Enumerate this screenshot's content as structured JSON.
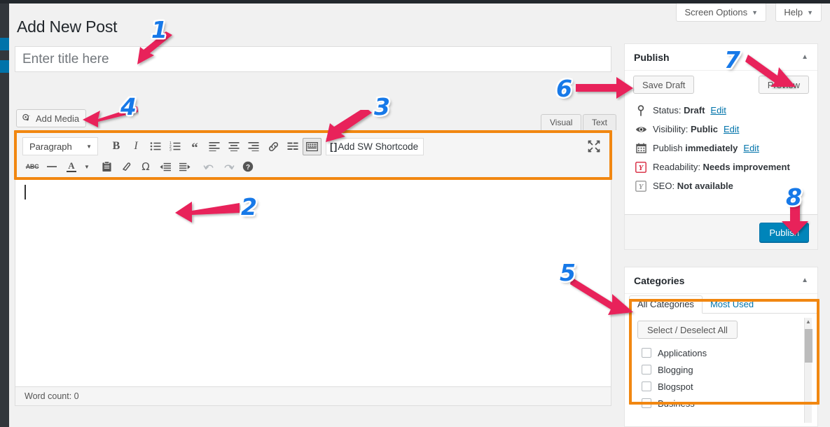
{
  "header": {
    "page_title": "Add New Post",
    "screen_options_label": "Screen Options",
    "help_label": "Help",
    "caret": "▼"
  },
  "title_field": {
    "placeholder": "Enter title here",
    "value": ""
  },
  "editor": {
    "add_media_label": "Add Media",
    "tabs": [
      {
        "label": "Visual",
        "active": true
      },
      {
        "label": "Text",
        "active": false
      }
    ],
    "format_select": {
      "value": "Paragraph",
      "caret": "▼"
    },
    "toolbar_row1": [
      {
        "name": "bold-icon",
        "glyph": "B",
        "state": "normal"
      },
      {
        "name": "italic-icon",
        "glyph": "I",
        "state": "normal"
      },
      {
        "name": "bulleted-list-icon",
        "glyph": "",
        "state": "normal"
      },
      {
        "name": "numbered-list-icon",
        "glyph": "",
        "state": "normal"
      },
      {
        "name": "blockquote-icon",
        "glyph": "“",
        "state": "normal"
      },
      {
        "name": "align-left-icon",
        "glyph": "",
        "state": "normal"
      },
      {
        "name": "align-center-icon",
        "glyph": "",
        "state": "normal"
      },
      {
        "name": "align-right-icon",
        "glyph": "",
        "state": "normal"
      },
      {
        "name": "insert-link-icon",
        "glyph": "",
        "state": "normal"
      },
      {
        "name": "read-more-icon",
        "glyph": "",
        "state": "normal"
      },
      {
        "name": "toolbar-toggle-icon",
        "glyph": "",
        "state": "active"
      }
    ],
    "toolbar_row2": [
      {
        "name": "strikethrough-icon",
        "glyph": "ABC",
        "state": "normal"
      },
      {
        "name": "horizontal-rule-icon",
        "glyph": "",
        "state": "normal"
      },
      {
        "name": "text-color-icon",
        "glyph": "A",
        "state": "normal"
      },
      {
        "name": "text-color-dropdown-icon",
        "glyph": "▼",
        "state": "normal"
      },
      {
        "name": "paste-as-text-icon",
        "glyph": "",
        "state": "normal"
      },
      {
        "name": "clear-formatting-icon",
        "glyph": "",
        "state": "normal"
      },
      {
        "name": "special-character-icon",
        "glyph": "Ω",
        "state": "normal"
      },
      {
        "name": "outdent-icon",
        "glyph": "",
        "state": "normal"
      },
      {
        "name": "indent-icon",
        "glyph": "",
        "state": "normal"
      },
      {
        "name": "undo-icon",
        "glyph": "",
        "state": "dim"
      },
      {
        "name": "redo-icon",
        "glyph": "",
        "state": "dim"
      },
      {
        "name": "keyboard-shortcuts-icon",
        "glyph": "?",
        "state": "normal"
      }
    ],
    "shortcode_button_label": "Add SW Shortcode",
    "shortcode_bracket_left": "[",
    "shortcode_bracket_right": "]",
    "content_value": "",
    "word_count_label": "Word count: 0"
  },
  "publish_panel": {
    "title": "Publish",
    "toggle": "▲",
    "save_draft_label": "Save Draft",
    "preview_label": "Preview",
    "rows": [
      {
        "icon": "pin-icon",
        "prefix": "Status: ",
        "value": "Draft",
        "edit": "Edit"
      },
      {
        "icon": "eye-icon",
        "prefix": "Visibility: ",
        "value": "Public",
        "edit": "Edit"
      },
      {
        "icon": "calendar-icon",
        "prefix": "Publish ",
        "value": "immediately",
        "edit": "Edit"
      },
      {
        "icon": "yoast-red-icon",
        "prefix": "Readability: ",
        "value": "Needs improvement",
        "edit": ""
      },
      {
        "icon": "yoast-gray-icon",
        "prefix": "SEO: ",
        "value": "Not available",
        "edit": ""
      }
    ],
    "publish_button_label": "Publish"
  },
  "categories_panel": {
    "title": "Categories",
    "toggle": "▲",
    "tabs": [
      {
        "label": "All Categories",
        "active": true
      },
      {
        "label": "Most Used",
        "active": false
      }
    ],
    "select_all_label": "Select / Deselect All",
    "items": [
      {
        "label": "Applications",
        "checked": false
      },
      {
        "label": "Blogging",
        "checked": false
      },
      {
        "label": "Blogspot",
        "checked": false
      },
      {
        "label": "Business",
        "checked": false
      }
    ]
  },
  "annotations": {
    "arrow_color": "#e8215a",
    "number_color": "#1779e8",
    "highlight_color": "#f18711",
    "markers": [
      {
        "id": "1",
        "target": "title-input"
      },
      {
        "id": "2",
        "target": "content-area"
      },
      {
        "id": "3",
        "target": "toolbar-toggle-icon"
      },
      {
        "id": "4",
        "target": "add-media-button"
      },
      {
        "id": "5",
        "target": "categories-list"
      },
      {
        "id": "6",
        "target": "save-draft-button"
      },
      {
        "id": "7",
        "target": "preview-button"
      },
      {
        "id": "8",
        "target": "publish-button"
      }
    ]
  }
}
